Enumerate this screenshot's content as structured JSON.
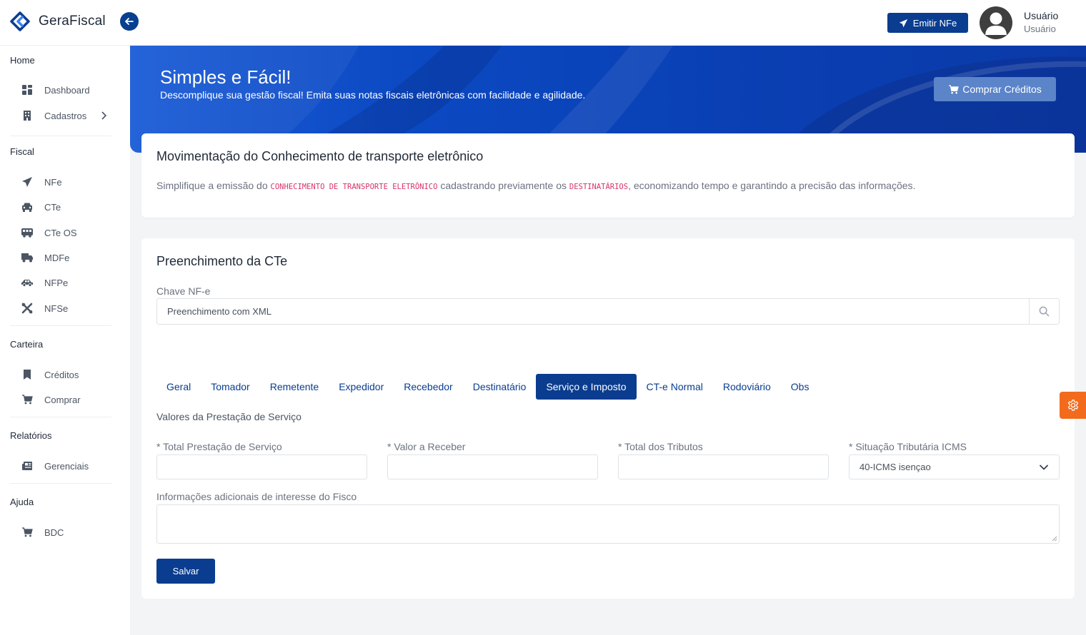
{
  "header": {
    "brand": "GeraFiscal",
    "emit_label": "Emitir NFe",
    "user_name": "Usuário",
    "user_role": "Usuário"
  },
  "sidebar": {
    "sections": [
      {
        "title": "Home",
        "items": [
          {
            "label": "Dashboard",
            "icon": "grid-icon"
          },
          {
            "label": "Cadastros",
            "icon": "building-icon"
          }
        ]
      },
      {
        "title": "Fiscal",
        "items": [
          {
            "label": "NFe",
            "icon": "paper-plane-icon"
          },
          {
            "label": "CTe",
            "icon": "car-icon"
          },
          {
            "label": "CTe OS",
            "icon": "bus-icon"
          },
          {
            "label": "MDFe",
            "icon": "truck-icon"
          },
          {
            "label": "NFPe",
            "icon": "car-side-icon"
          },
          {
            "label": "NFSe",
            "icon": "tools-icon"
          }
        ]
      },
      {
        "title": "Carteira",
        "items": [
          {
            "label": "Créditos",
            "icon": "bookmark-icon"
          },
          {
            "label": "Comprar",
            "icon": "cart-icon"
          }
        ]
      },
      {
        "title": "Relatórios",
        "items": [
          {
            "label": "Gerenciais",
            "icon": "newspaper-icon"
          }
        ]
      },
      {
        "title": "Ajuda",
        "items": [
          {
            "label": "BDC",
            "icon": "cart-icon"
          }
        ]
      }
    ]
  },
  "banner": {
    "title": "Simples e Fácil!",
    "subtitle": "Descomplique sua gestão fiscal! Emita suas notas fiscais eletrônicas com facilidade e agilidade.",
    "buy_label": "Comprar Créditos"
  },
  "intro": {
    "title": "Movimentação do Conhecimento de transporte eletrônico",
    "text_1": "Simplifique a emissão do ",
    "code_1": "CONHECIMENTO DE TRANSPORTE ELETRÔNICO",
    "text_2": " cadastrando previamente os ",
    "code_2": "DESTINATÁRIOS",
    "text_3": ", economizando tempo e garantindo a precisão das informações."
  },
  "form": {
    "title": "Preenchimento da CTe",
    "chave_label": "Chave NF-e",
    "chave_value": "Preenchimento com XML",
    "tabs": [
      "Geral",
      "Tomador",
      "Remetente",
      "Expedidor",
      "Recebedor",
      "Destinatário",
      "Serviço e Imposto",
      "CT-e Normal",
      "Rodoviário",
      "Obs"
    ],
    "active_tab": "Serviço e Imposto",
    "section_label": "Valores da Prestação de Serviço",
    "fields": {
      "total_prestacao": "* Total Prestação de Serviço",
      "valor_receber": "* Valor a Receber",
      "total_tributos": "* Total dos Tributos",
      "situacao_icms": "* Situação Tributária ICMS",
      "situacao_icms_value": "40-ICMS isençao"
    },
    "info_label": "Informações adicionais de interesse do Fisco",
    "save_label": "Salvar"
  },
  "colors": {
    "primary": "#0a3d8f",
    "banner": "#0b49c2",
    "accent_orange": "#f26b1d",
    "code_pink": "#d6336c"
  }
}
